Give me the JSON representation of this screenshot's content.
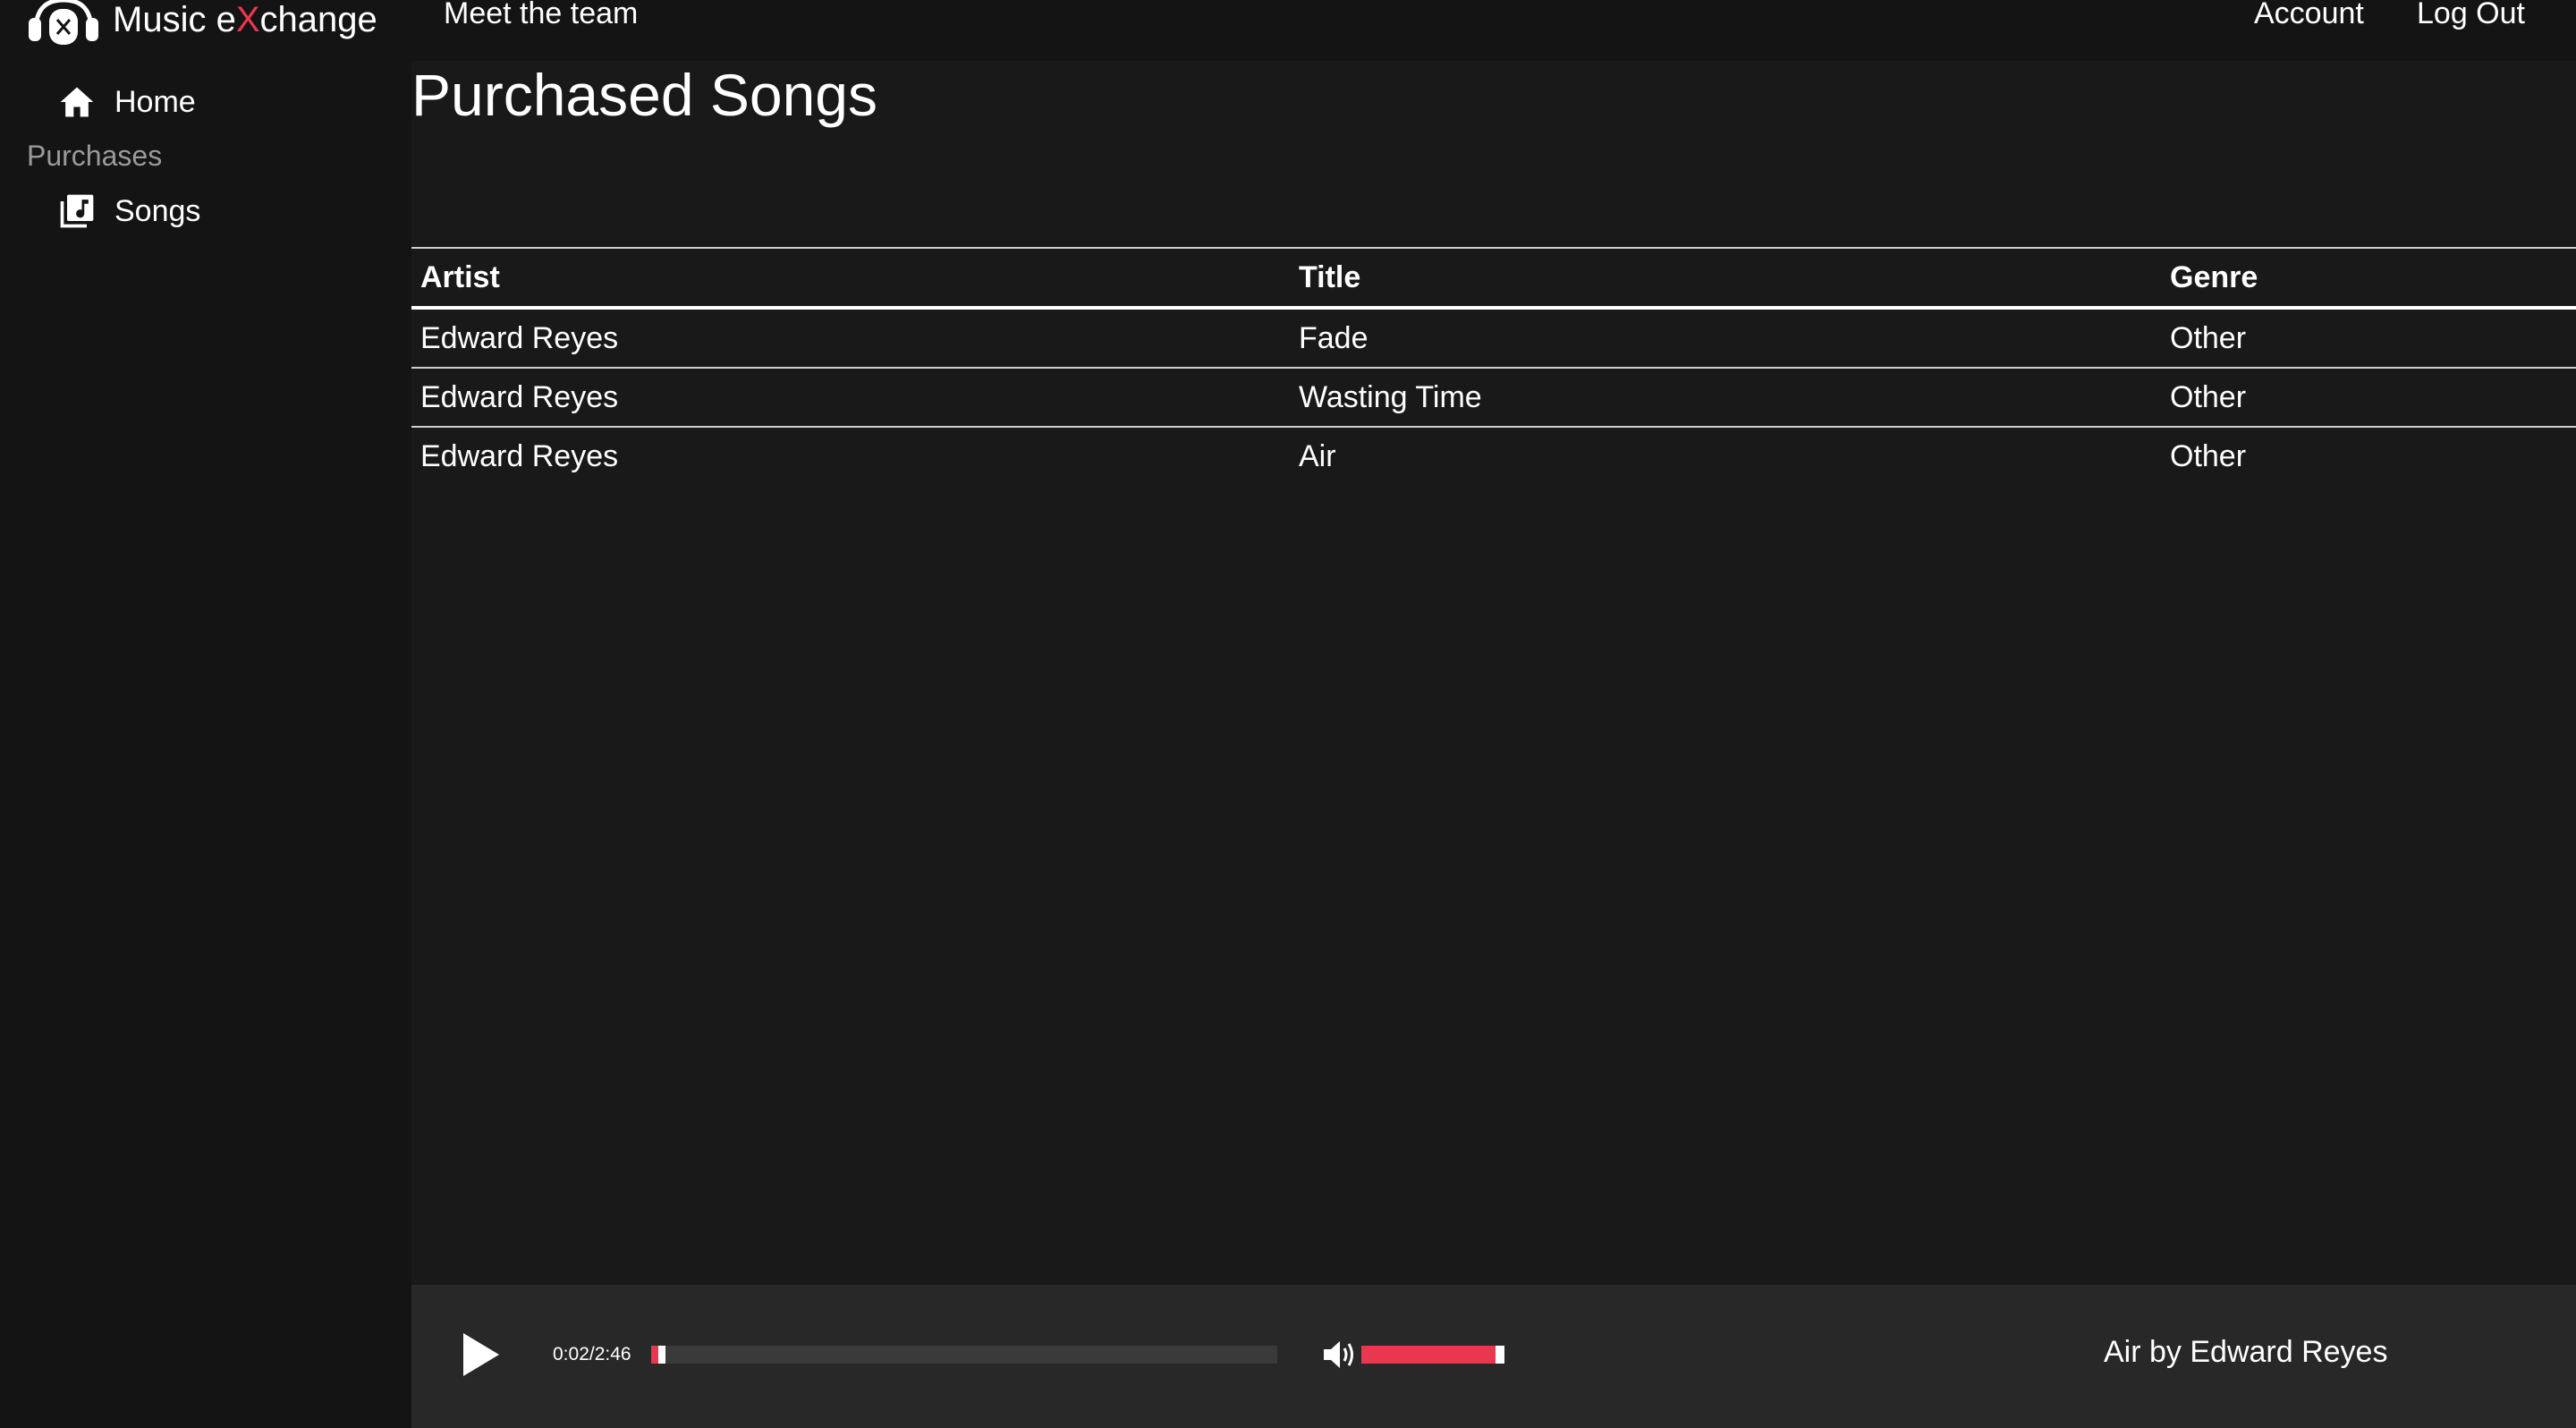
{
  "header": {
    "logo_text_pre": "Music e",
    "logo_text_x": "X",
    "logo_text_post": "change",
    "logo_icon": "headphones-logo-icon",
    "nav": {
      "team": "Meet the team",
      "account": "Account",
      "logout": "Log Out"
    }
  },
  "sidebar": {
    "home": {
      "label": "Home",
      "icon": "home-icon"
    },
    "purchases_heading": "Purchases",
    "songs": {
      "label": "Songs",
      "icon": "music-library-icon"
    }
  },
  "main": {
    "title": "Purchased Songs",
    "table": {
      "headers": {
        "artist": "Artist",
        "title": "Title",
        "genre": "Genre"
      },
      "rows": [
        {
          "artist": "Edward Reyes",
          "title": "Fade",
          "genre": "Other"
        },
        {
          "artist": "Edward Reyes",
          "title": "Wasting Time",
          "genre": "Other"
        },
        {
          "artist": "Edward Reyes",
          "title": "Air",
          "genre": "Other"
        }
      ]
    }
  },
  "player": {
    "play_icon": "play-icon",
    "volume_icon": "volume-icon",
    "time": "0:02/2:46",
    "progress_fraction": 0.012,
    "volume_fraction": 1.0,
    "now_playing": "Air by Edward Reyes"
  },
  "colors": {
    "accent": "#e8374e",
    "background": "#191919",
    "sidebar": "#141414",
    "player": "#282828"
  }
}
